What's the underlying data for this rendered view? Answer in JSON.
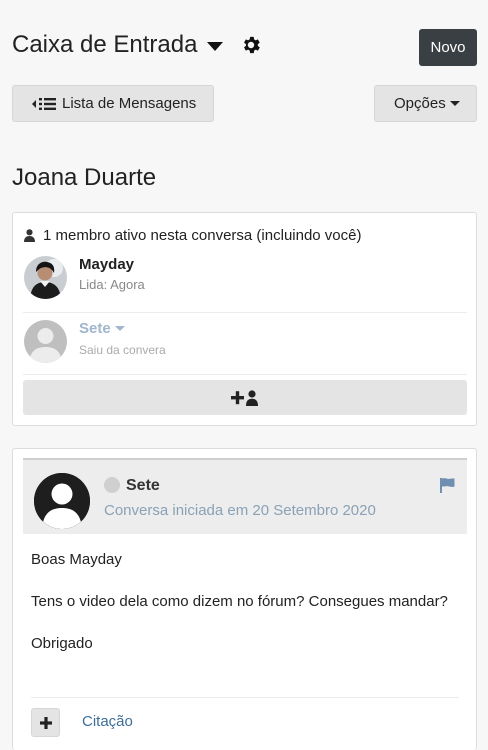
{
  "header": {
    "title": "Caixa de Entrada",
    "new_label": "Novo"
  },
  "toolbar": {
    "list_label": "Lista de Mensagens",
    "options_label": "Opções"
  },
  "conversation": {
    "title": "Joana Duarte"
  },
  "members_panel": {
    "summary": "1 membro ativo nesta conversa (incluindo você)",
    "members": [
      {
        "name": "Mayday",
        "status": "Lida: Agora"
      },
      {
        "name": "Sete",
        "status": "Saiu da convera"
      }
    ]
  },
  "post": {
    "author": "Sete",
    "meta": "Conversa iniciada em 20 Setembro 2020",
    "body": [
      "Boas Mayday",
      "Tens o video dela como dizem no fórum? Consegues mandar?",
      "Obrigado"
    ],
    "quote_label": "Citação"
  },
  "colors": {
    "dark_button": "#3a3f44",
    "link": "#3d6f99",
    "muted_name": "#9fb6cc",
    "meta": "#8aa1b6"
  },
  "icons": [
    "caret-down-icon",
    "gear-icon",
    "list-icon",
    "user-icon",
    "add-user-icon",
    "flag-icon",
    "plus-icon"
  ]
}
